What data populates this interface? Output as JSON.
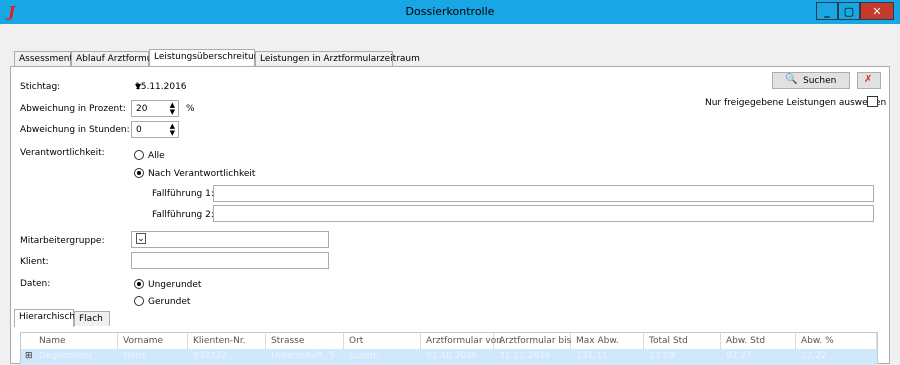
{
  "window": {
    "title": "Dossierkontrolle",
    "min": "_",
    "max": "▢",
    "close": "✕",
    "app_icon": "J"
  },
  "tabs": [
    "Assessment",
    "Ablauf Arztformular",
    "Leistungsüberschreitung",
    "Leistungen in Arztformularzeitraum"
  ],
  "form": {
    "stichtag_label": "Stichtag:",
    "stichtag_value": "15.11.2016",
    "abw_prozent_label": "Abweichung in Prozent:",
    "abw_prozent_value": "20",
    "abw_prozent_unit": "%",
    "abw_stunden_label": "Abweichung in Stunden:",
    "abw_stunden_value": "0",
    "verantwortlichkeit_label": "Verantwortlichkeit:",
    "radio_alle": "Alle",
    "radio_nach": "Nach Verantwortlichkeit",
    "fallfuehrung1_label": "Fallführung 1:",
    "fallfuehrung2_label": "Fallführung 2:",
    "mitarbeitergruppe_label": "Mitarbeitergruppe:",
    "klient_label": "Klient:",
    "daten_label": "Daten:",
    "radio_ungerundet": "Ungerundet",
    "radio_gerundet": "Gerundet",
    "suchen_label": "Suchen",
    "nur_freigegebene_label": "Nur freigegebene Leistungen auswerten"
  },
  "subtabs": [
    "Hierarchisch",
    "Flach"
  ],
  "grid": {
    "headers": [
      "Name",
      "Vorname",
      "Klienten-Nr.",
      "Strasse",
      "Ort",
      "Arztformular von",
      "Arztformular bis",
      "Max Abw.",
      "Total Std",
      "Abw. Std",
      "Abw. %"
    ],
    "row": [
      "Gegenreiter",
      "Hans",
      "932322",
      "Unterschaft. 5",
      "Luzern",
      "01.10.2016",
      "31.12.2016",
      "131:11",
      "13:09",
      "02:27",
      "22,22"
    ]
  },
  "colors": {
    "titlebar": "#19a6e5",
    "close": "#c7392a",
    "accent_icon": "#e0201f"
  }
}
